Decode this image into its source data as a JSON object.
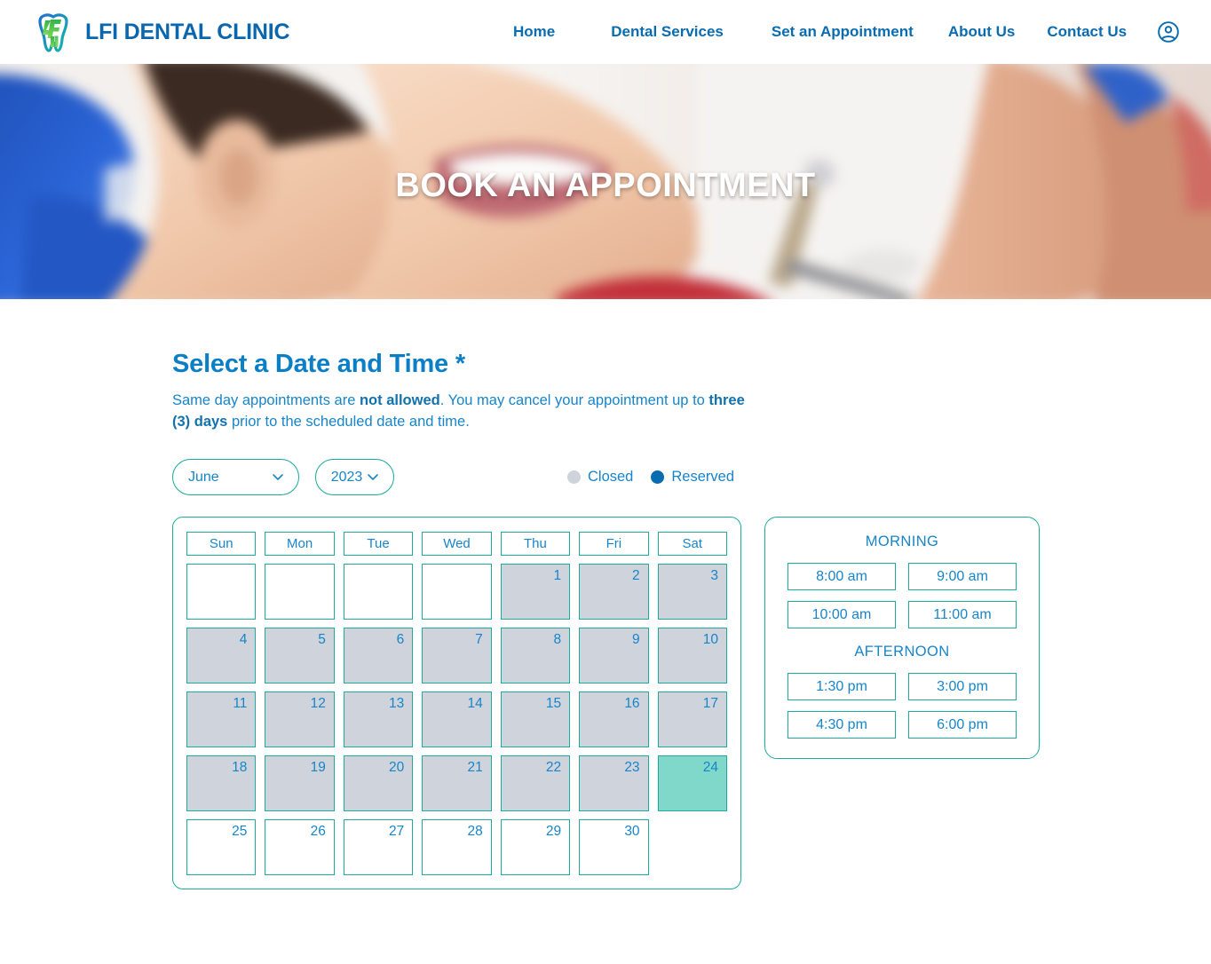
{
  "header": {
    "brand_name": "LFI DENTAL CLINIC",
    "logo_icon": "tooth-logo-icon",
    "account_icon": "user-account-icon",
    "nav": [
      {
        "label": "Home",
        "key": "home"
      },
      {
        "label": "Dental Services",
        "key": "services"
      },
      {
        "label": "Set an Appointment",
        "key": "appointment"
      },
      {
        "label": "About Us",
        "key": "about"
      },
      {
        "label": "Contact Us",
        "key": "contact"
      }
    ]
  },
  "hero": {
    "title": "BOOK AN APPOINTMENT"
  },
  "booking": {
    "section_title": "Select a Date and Time *",
    "note_part1": "Same day appointments are ",
    "note_bold1": "not allowed",
    "note_part2": ". You may cancel your appointment up to ",
    "note_bold2": "three (3) days",
    "note_part3": " prior to the scheduled date and time.",
    "month_value": "June",
    "year_value": "2023",
    "chevron_icon": "chevron-down-icon",
    "legend": [
      {
        "label": "Closed",
        "color": "#ced3dc"
      },
      {
        "label": "Reserved",
        "color": "#0a6cb0"
      }
    ],
    "colors": {
      "accent_blue": "#1785c9",
      "brand_blue": "#0a6cb0",
      "border_teal": "#1cab9c",
      "closed_gray": "#ced3dc",
      "selected_teal": "#7fd8ca"
    },
    "calendar": {
      "day_names": [
        "Sun",
        "Mon",
        "Tue",
        "Wed",
        "Thu",
        "Fri",
        "Sat"
      ],
      "leading_blanks": 4,
      "weeks": [
        [
          {
            "label": "",
            "state": "blank"
          },
          {
            "label": "",
            "state": "blank"
          },
          {
            "label": "",
            "state": "blank"
          },
          {
            "label": "",
            "state": "blank"
          },
          {
            "label": "1",
            "state": "closed"
          },
          {
            "label": "2",
            "state": "closed"
          },
          {
            "label": "3",
            "state": "closed"
          }
        ],
        [
          {
            "label": "4",
            "state": "closed"
          },
          {
            "label": "5",
            "state": "closed"
          },
          {
            "label": "6",
            "state": "closed"
          },
          {
            "label": "7",
            "state": "closed"
          },
          {
            "label": "8",
            "state": "closed"
          },
          {
            "label": "9",
            "state": "closed"
          },
          {
            "label": "10",
            "state": "closed"
          }
        ],
        [
          {
            "label": "11",
            "state": "closed"
          },
          {
            "label": "12",
            "state": "closed"
          },
          {
            "label": "13",
            "state": "closed"
          },
          {
            "label": "14",
            "state": "closed"
          },
          {
            "label": "15",
            "state": "closed"
          },
          {
            "label": "16",
            "state": "closed"
          },
          {
            "label": "17",
            "state": "closed"
          }
        ],
        [
          {
            "label": "18",
            "state": "closed"
          },
          {
            "label": "19",
            "state": "closed"
          },
          {
            "label": "20",
            "state": "closed"
          },
          {
            "label": "21",
            "state": "closed"
          },
          {
            "label": "22",
            "state": "closed"
          },
          {
            "label": "23",
            "state": "closed"
          },
          {
            "label": "24",
            "state": "selected"
          }
        ],
        [
          {
            "label": "25",
            "state": "available"
          },
          {
            "label": "26",
            "state": "available"
          },
          {
            "label": "27",
            "state": "available"
          },
          {
            "label": "28",
            "state": "available"
          },
          {
            "label": "29",
            "state": "available"
          },
          {
            "label": "30",
            "state": "available"
          },
          {
            "label": "",
            "state": "empty-slot"
          }
        ]
      ]
    },
    "times": {
      "morning_heading": "MORNING",
      "morning_slots": [
        "8:00 am",
        "9:00 am",
        "10:00 am",
        "11:00 am"
      ],
      "afternoon_heading": "AFTERNOON",
      "afternoon_slots": [
        "1:30 pm",
        "3:00 pm",
        "4:30 pm",
        "6:00 pm"
      ]
    }
  }
}
